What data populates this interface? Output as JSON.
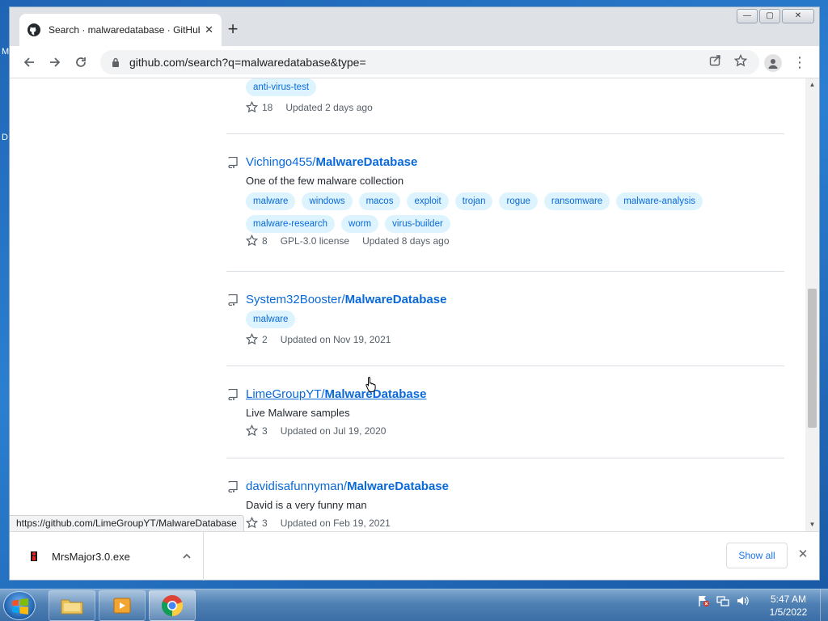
{
  "desktop": {
    "edge_letters": [
      "M",
      "D"
    ]
  },
  "browser": {
    "tab": {
      "title": "Search · malwaredatabase · GitHub"
    },
    "new_tab_label": "+",
    "window_controls": {
      "minimize": "—",
      "maximize": "▢",
      "close": "✕"
    },
    "url": "github.com/search?q=malwaredatabase&type="
  },
  "results": [
    {
      "owner": "",
      "name": "",
      "description": "",
      "topics": [
        "anti-virus-test"
      ],
      "stars": "18",
      "license": "",
      "updated": "Updated 2 days ago"
    },
    {
      "owner": "Vichingo455/",
      "name": "MalwareDatabase",
      "description": "One of the few malware collection",
      "topics": [
        "malware",
        "windows",
        "macos",
        "exploit",
        "trojan",
        "rogue",
        "ransomware",
        "malware-analysis",
        "malware-research",
        "worm",
        "virus-builder"
      ],
      "stars": "8",
      "license": "GPL-3.0 license",
      "updated": "Updated 8 days ago"
    },
    {
      "owner": "System32Booster/",
      "name": "MalwareDatabase",
      "description": "",
      "topics": [
        "malware"
      ],
      "stars": "2",
      "license": "",
      "updated": "Updated on Nov 19, 2021"
    },
    {
      "owner": "LimeGroupYT/",
      "name": "MalwareDatabase",
      "description": "Live Malware samples",
      "topics": [],
      "stars": "3",
      "license": "",
      "updated": "Updated on Jul 19, 2020"
    },
    {
      "owner": "davidisafunnyman/",
      "name": "MalwareDatabase",
      "description": "David is a very funny man",
      "topics": [],
      "stars": "3",
      "license": "",
      "updated": "Updated on Feb 19, 2021"
    }
  ],
  "status_url": "https://github.com/LimeGroupYT/MalwareDatabase",
  "downloads": {
    "file_name": "MrsMajor3.0.exe",
    "show_all_label": "Show all",
    "close_label": "✕"
  },
  "taskbar": {
    "time": "5:47 AM",
    "date": "1/5/2022"
  },
  "colors": {
    "link": "#0969da",
    "topic_bg": "#ddf4ff",
    "chrome_frame": "#dee1e6"
  }
}
